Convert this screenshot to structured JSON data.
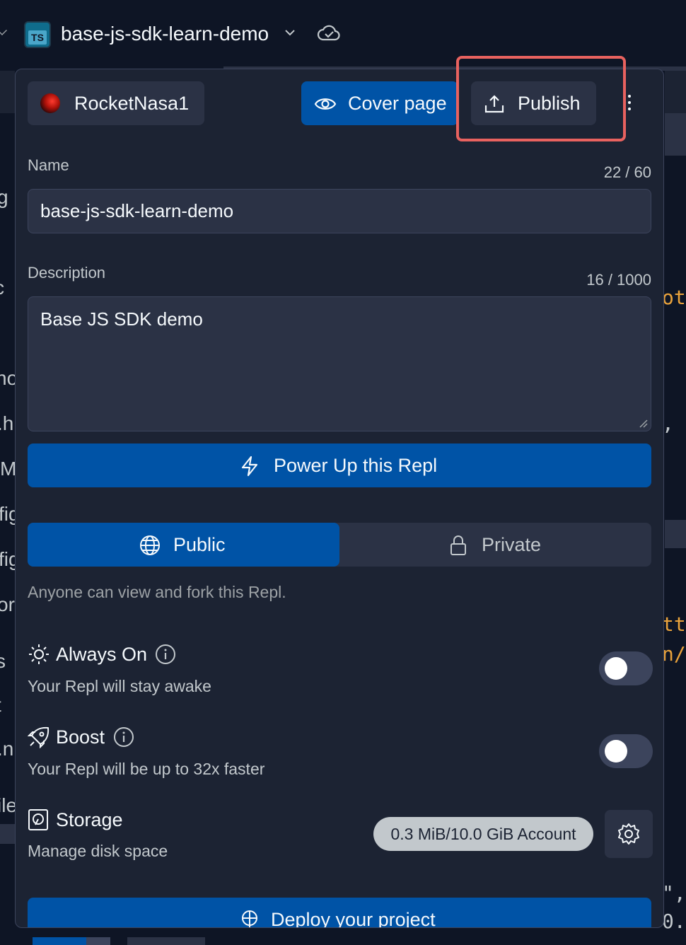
{
  "header": {
    "repl_title": "base-js-sdk-learn-demo",
    "language_badge": "TS"
  },
  "background": {
    "left_fragments": [
      "g",
      "c",
      "no",
      ".h",
      "M",
      "fig",
      "fig",
      "or",
      "s",
      "t",
      ".n",
      "ile"
    ],
    "right_fragments": [
      "ot",
      ",",
      "tt",
      "n/",
      "\",",
      "0."
    ]
  },
  "popup": {
    "owner": {
      "name": "RocketNasa1"
    },
    "buttons": {
      "cover_page": "Cover page",
      "publish": "Publish",
      "power_up": "Power Up this Repl",
      "deploy": "Deploy your project"
    },
    "name_field": {
      "label": "Name",
      "value": "base-js-sdk-learn-demo",
      "counter": "22 / 60"
    },
    "description_field": {
      "label": "Description",
      "value": "Base JS SDK demo",
      "counter": "16 / 1000"
    },
    "visibility": {
      "selected": "Public",
      "public_label": "Public",
      "private_label": "Private",
      "hint": "Anyone can view and fork this Repl."
    },
    "always_on": {
      "title": "Always On",
      "description": "Your Repl will stay awake",
      "enabled": false
    },
    "boost": {
      "title": "Boost",
      "description": "Your Repl will be up to 32x faster",
      "enabled": false
    },
    "storage": {
      "title": "Storage",
      "description": "Manage disk space",
      "usage": "0.3 MiB/10.0 GiB Account"
    }
  },
  "colors": {
    "background": "#0e1525",
    "panel": "#1c2333",
    "control": "#2b3245",
    "primary": "#0053a6",
    "highlight": "#e8625f"
  },
  "icons": [
    "chevron-left-icon",
    "typescript-icon",
    "chevron-down-icon",
    "cloud-check-icon",
    "eye-icon",
    "upload-icon",
    "kebab-menu-icon",
    "lightning-icon",
    "globe-icon",
    "lock-icon",
    "sun-icon",
    "info-icon",
    "rocket-icon",
    "storage-icon",
    "gear-icon",
    "deploy-icon"
  ]
}
